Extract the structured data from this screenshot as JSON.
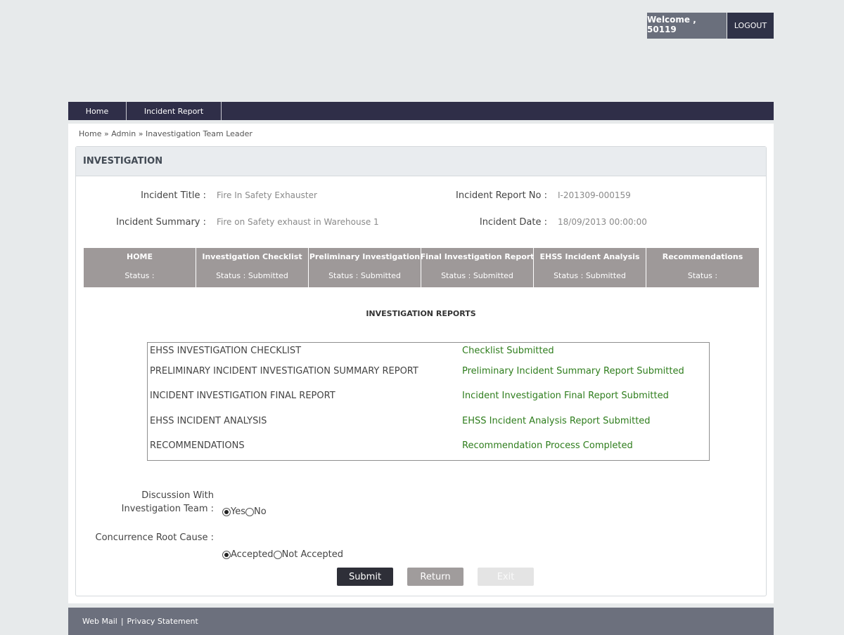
{
  "header": {
    "welcome": "Welcome , 50119",
    "logout": "LOGOUT"
  },
  "nav": {
    "home": "Home",
    "incident_report": "Incident Report"
  },
  "breadcrumb": {
    "home": "Home",
    "sep1": "»",
    "admin": "Admin",
    "sep2": "»",
    "current": "Inavestigation Team Leader"
  },
  "panel": {
    "title": "INVESTIGATION"
  },
  "incident": {
    "title_label": "Incident Title :",
    "title_value": "Fire In Safety Exhauster",
    "report_no_label": "Incident Report No :",
    "report_no_value": "I-201309-000159",
    "summary_label": "Incident Summary :",
    "summary_value": "Fire on Safety exhaust in Warehouse 1",
    "date_label": "Incident Date :",
    "date_value": "18/09/2013 00:00:00"
  },
  "tabs": [
    {
      "title": "HOME",
      "status": "Status :"
    },
    {
      "title": "Investigation Checklist",
      "status": "Status : Submitted"
    },
    {
      "title": "Preliminary Investigation",
      "status": "Status : Submitted"
    },
    {
      "title": "Final Investigation Report",
      "status": "Status : Submitted"
    },
    {
      "title": "EHSS Incident Analysis",
      "status": "Status : Submitted"
    },
    {
      "title": "Recommendations",
      "status": "Status :"
    }
  ],
  "reports": {
    "heading": "INVESTIGATION REPORTS",
    "rows": [
      {
        "name": "EHSS INVESTIGATION CHECKLIST",
        "status": "Checklist Submitted"
      },
      {
        "name": "PRELIMINARY INCIDENT INVESTIGATION SUMMARY REPORT",
        "status": "Preliminary Incident Summary Report Submitted"
      },
      {
        "name": "INCIDENT INVESTIGATION FINAL REPORT",
        "status": "Incident Investigation Final Report Submitted"
      },
      {
        "name": "EHSS INCIDENT ANALYSIS",
        "status": "EHSS Incident Analysis Report Submitted"
      },
      {
        "name": "RECOMMENDATIONS",
        "status": "Recommendation Process Completed"
      }
    ]
  },
  "discussion": {
    "label_line1": "Discussion With",
    "label_line2": "Investigation Team :",
    "options": [
      "Yes",
      "No"
    ],
    "selected": "Yes"
  },
  "concurrence": {
    "label": "Concurrence Root Cause :",
    "options": [
      "Accepted",
      "Not Accepted"
    ],
    "selected": "Accepted"
  },
  "buttons": {
    "submit": "Submit",
    "return": "Return",
    "exit": "Exit"
  },
  "footer": {
    "webmail": "Web Mail",
    "separator": "|",
    "privacy": "Privacy Statement"
  }
}
